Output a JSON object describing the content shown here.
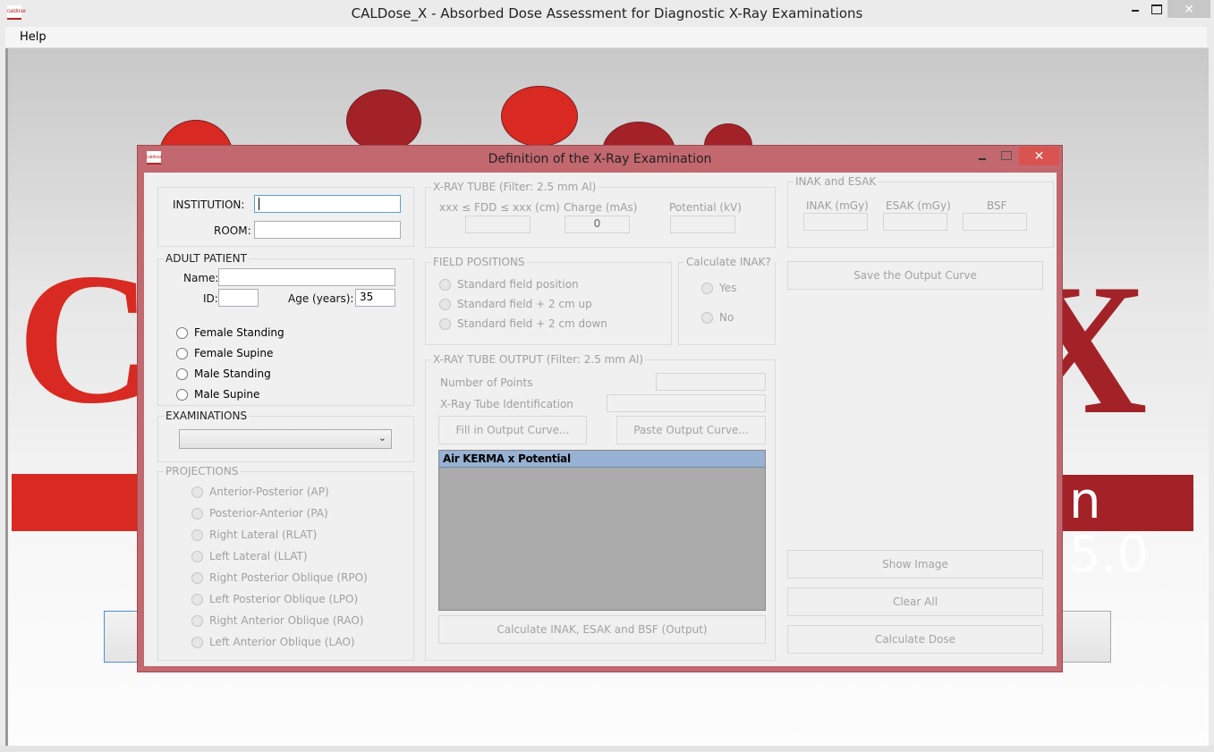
{
  "app": {
    "title": "CALDose_X - Absorbed Dose Assessment for Diagnostic X-Ray Examinations",
    "icon_label": "caldose",
    "close_glyph": "✕",
    "menu": [
      {
        "label": "Help"
      }
    ]
  },
  "background": {
    "version_text": "n 5.0",
    "letter_left": "C",
    "letter_right": "X",
    "colors": {
      "dark_red": "#a32228",
      "bright_red": "#d82a22"
    }
  },
  "dialog": {
    "title": "Definition of the X-Ray Examination",
    "close_glyph": "✕",
    "institution": {
      "label": "INSTITUTION:",
      "value": ""
    },
    "room": {
      "label": "ROOM:",
      "value": ""
    },
    "adult_patient": {
      "legend": "ADULT PATIENT",
      "name_label": "Name:",
      "name_value": "",
      "id_label": "ID:",
      "id_value": "",
      "age_label": "Age (years):",
      "age_value": "35",
      "phantoms": [
        {
          "label": "Female Standing",
          "checked": false
        },
        {
          "label": "Female Supine",
          "checked": false
        },
        {
          "label": "Male Standing",
          "checked": false
        },
        {
          "label": "Male Supine",
          "checked": false
        }
      ]
    },
    "examinations": {
      "legend": "EXAMINATIONS",
      "selected": "",
      "chevron": "⌄"
    },
    "projections": {
      "legend": "PROJECTIONS",
      "items": [
        {
          "label": "Anterior-Posterior (AP)"
        },
        {
          "label": "Posterior-Anterior (PA)"
        },
        {
          "label": "Right Lateral (RLAT)"
        },
        {
          "label": "Left Lateral (LLAT)"
        },
        {
          "label": "Right Posterior Oblique (RPO)"
        },
        {
          "label": "Left Posterior Oblique (LPO)"
        },
        {
          "label": "Right Anterior Oblique (RAO)"
        },
        {
          "label": "Left Anterior Oblique (LAO)"
        }
      ]
    },
    "xray_tube": {
      "legend": "X-RAY TUBE (Filter: 2.5 mm Al)",
      "fdd_label": "xxx ≤ FDD ≤ xxx (cm)",
      "fdd_value": "",
      "charge_label": "Charge (mAs)",
      "charge_value": "0",
      "potential_label": "Potential (kV)",
      "potential_value": ""
    },
    "field_positions": {
      "legend": "FIELD POSITIONS",
      "items": [
        {
          "label": "Standard field position"
        },
        {
          "label": "Standard field + 2 cm up"
        },
        {
          "label": "Standard field + 2 cm down"
        }
      ]
    },
    "calculate_inak": {
      "legend": "Calculate INAK?",
      "yes_label": "Yes",
      "no_label": "No"
    },
    "tube_output": {
      "legend": "X-RAY TUBE OUTPUT (Filter: 2.5 mm Al)",
      "points_label": "Number of Points",
      "points_value": "",
      "tube_id_label": "X-Ray Tube Identification",
      "tube_id_value": "",
      "fill_button": "Fill in Output Curve...",
      "paste_button": "Paste Output Curve...",
      "grid_header": "Air KERMA x Potential",
      "calc_button": "Calculate INAK, ESAK and BSF (Output)"
    },
    "inak_esak": {
      "legend": "INAK and ESAK",
      "inak_label": "INAK (mGy)",
      "inak_value": "",
      "esak_label": "ESAK (mGy)",
      "esak_value": "",
      "bsf_label": "BSF",
      "bsf_value": ""
    },
    "buttons": {
      "save_curve": "Save the Output Curve",
      "show_image": "Show Image",
      "clear_all": "Clear All",
      "calculate_dose": "Calculate Dose"
    },
    "colors": {
      "frame": "#c3686f",
      "close": "#d9534f",
      "grid_header": "#97b2d2",
      "grid_body": "#ababab"
    }
  }
}
